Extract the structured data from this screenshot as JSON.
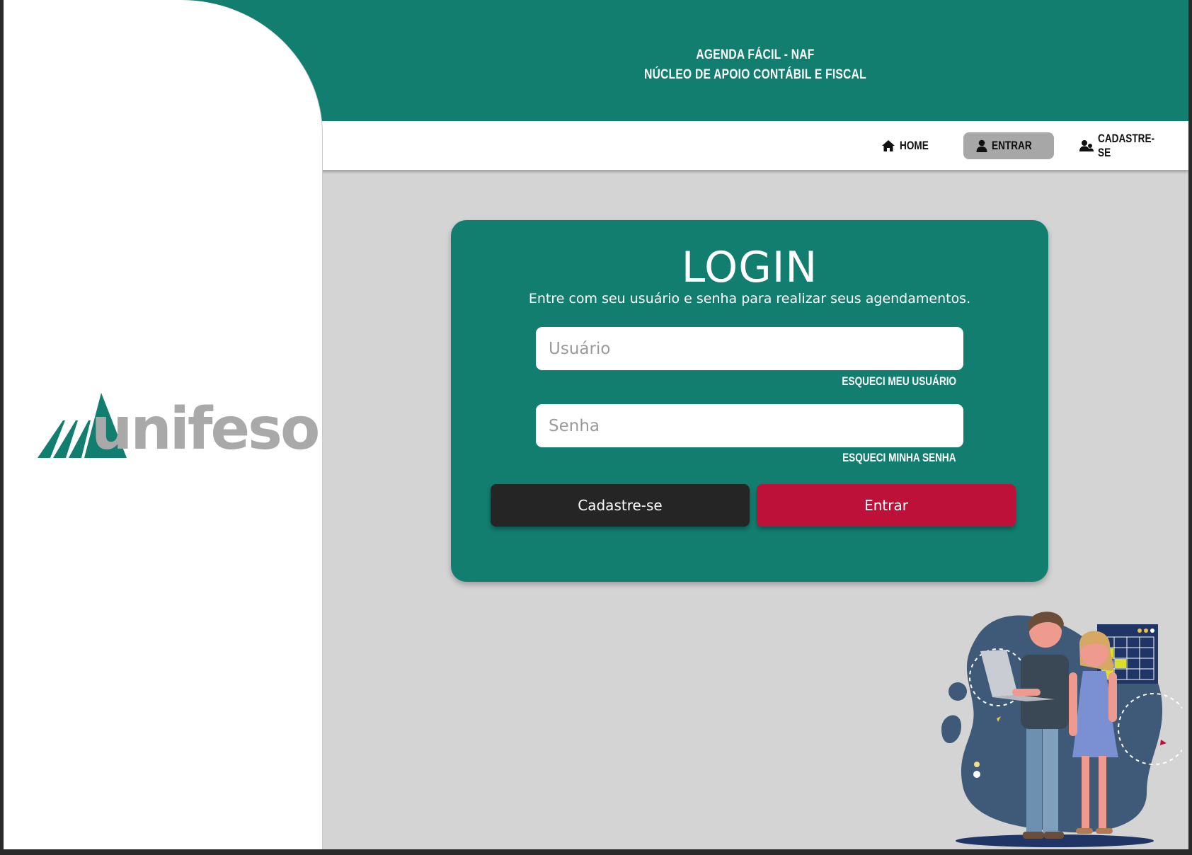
{
  "header": {
    "title_line1": "AGENDA FÁCIL - NAF",
    "title_line2": "NÚCLEO DE APOIO CONTÁBIL E FISCAL"
  },
  "nav": {
    "items": [
      {
        "label": "HOME",
        "icon": "home-icon"
      },
      {
        "label": "ENTRAR",
        "icon": "user-icon",
        "active": true
      },
      {
        "label": "CADASTRE-SE",
        "icon": "users-icon"
      }
    ]
  },
  "logo": {
    "text": "unifeso"
  },
  "login": {
    "title": "LOGIN",
    "subtitle": "Entre com seu usuário e senha para realizar seus agendamentos.",
    "username_placeholder": "Usuário",
    "username_value": "",
    "password_placeholder": "Senha",
    "password_value": "",
    "forgot_user": "ESQUECI MEU USUÁRIO",
    "forgot_password": "ESQUECI MINHA SENHA",
    "register_button": "Cadastre-se",
    "submit_button": "Entrar"
  },
  "colors": {
    "primary_teal": "#127e70",
    "nav_active_bg": "#a7a7a7",
    "button_dark": "#252525",
    "button_red": "#be113a",
    "page_bg": "#d4d4d4"
  }
}
